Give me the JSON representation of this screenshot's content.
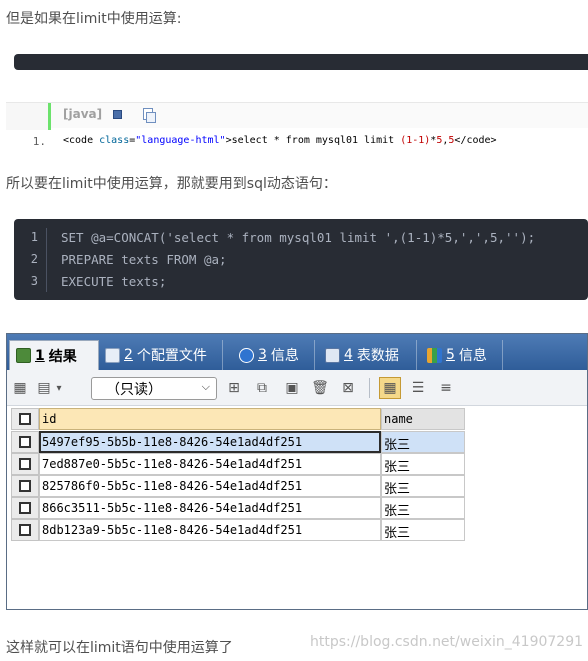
{
  "article": {
    "para1": "但是如果在limit中使用运算:",
    "para2": "所以要在limit中使用运算，那就要用到sql动态语句：",
    "para3": "这样就可以在limit语句中使用运算了"
  },
  "legacy_code": {
    "lang": "[java]",
    "line_number": "1.",
    "tokens": {
      "t1": "<code ",
      "t2": "class",
      "t3": "=",
      "t4": "\"language-html\"",
      "t5": ">select * from mysql01 limit ",
      "t6": "(1-1)",
      "t7": "*",
      "t8": "5",
      "t9": ",",
      "t10": "5",
      "t11": "</code>"
    }
  },
  "code_block": {
    "lines": [
      {
        "n": "1",
        "text": "SET @a=CONCAT('select * from mysql01 limit ',(1-1)*5,',',5,'');"
      },
      {
        "n": "2",
        "text": "PREPARE texts FROM @a;"
      },
      {
        "n": "3",
        "text": "EXECUTE texts;"
      }
    ]
  },
  "result_window": {
    "tabs": [
      {
        "num": "1",
        "label": "结果",
        "icon": "table-result-icon"
      },
      {
        "num": "2",
        "label": "个配置文件",
        "icon": "profile-icon"
      },
      {
        "num": "3",
        "label": "信息",
        "icon": "info-icon"
      },
      {
        "num": "4",
        "label": "表数据",
        "icon": "table-data-icon"
      },
      {
        "num": "5",
        "label": "信息",
        "icon": "info-color-icon"
      }
    ],
    "mode_select": "（只读）",
    "columns": [
      "id",
      "name"
    ],
    "rows": [
      {
        "id": "5497ef95-5b5b-11e8-8426-54e1ad4df251",
        "name": "张三"
      },
      {
        "id": "7ed887e0-5b5c-11e8-8426-54e1ad4df251",
        "name": "张三"
      },
      {
        "id": "825786f0-5b5c-11e8-8426-54e1ad4df251",
        "name": "张三"
      },
      {
        "id": "866c3511-5b5c-11e8-8426-54e1ad4df251",
        "name": "张三"
      },
      {
        "id": "8db123a9-5b5c-11e8-8426-54e1ad4df251",
        "name": "张三"
      }
    ]
  },
  "watermark": "https://blog.csdn.net/weixin_41907291",
  "colors": {
    "tab_bar": "#3b6aa8",
    "code_bg": "#282c34",
    "id_header": "#fce7b6",
    "selected_row": "#cfe1f7"
  }
}
